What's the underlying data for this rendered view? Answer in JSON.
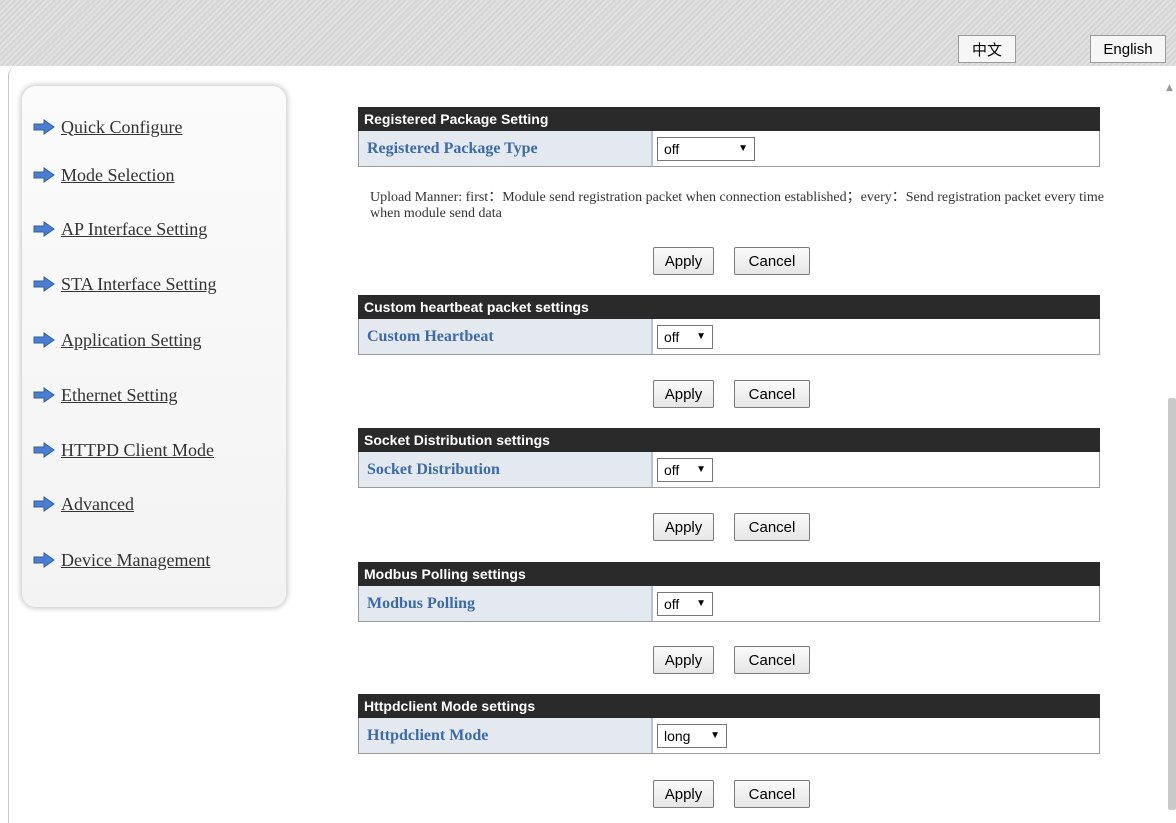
{
  "lang": {
    "chinese": "中文",
    "english": "English"
  },
  "nav": {
    "items": [
      {
        "label": "Quick Configure"
      },
      {
        "label": "Mode Selection"
      },
      {
        "label": "AP Interface Setting"
      },
      {
        "label": "STA Interface Setting"
      },
      {
        "label": "Application Setting"
      },
      {
        "label": "Ethernet Setting"
      },
      {
        "label": "HTTPD Client Mode"
      },
      {
        "label": "Advanced"
      },
      {
        "label": "Device Management"
      }
    ]
  },
  "sections": {
    "registered": {
      "header": "Registered Package Setting",
      "label": "Registered Package Type",
      "value": "off",
      "note": "Upload Manner: first：Module send registration packet when connection established；every：Send registration packet every time when module send data",
      "apply": "Apply",
      "cancel": "Cancel"
    },
    "heartbeat": {
      "header": "Custom heartbeat packet settings",
      "label": "Custom Heartbeat",
      "value": "off",
      "apply": "Apply",
      "cancel": "Cancel"
    },
    "socket": {
      "header": "Socket Distribution settings",
      "label": "Socket Distribution",
      "value": "off",
      "apply": "Apply",
      "cancel": "Cancel"
    },
    "modbus": {
      "header": "Modbus Polling settings",
      "label": "Modbus Polling",
      "value": "off",
      "apply": "Apply",
      "cancel": "Cancel"
    },
    "httpd": {
      "header": "Httpdclient Mode settings",
      "label": "Httpdclient Mode",
      "value": "long",
      "apply": "Apply",
      "cancel": "Cancel"
    }
  },
  "colors": {
    "header_bg": "#2a2a2a",
    "label_text": "#3c6ba5",
    "label_bg": "#e4e9ef",
    "arrow_icon": "#4a7fd0"
  }
}
